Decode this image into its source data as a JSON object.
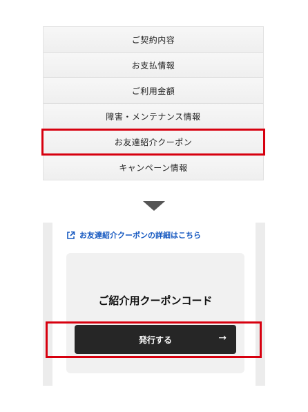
{
  "menu": {
    "items": [
      {
        "label": "ご契約内容"
      },
      {
        "label": "お支払情報"
      },
      {
        "label": "ご利用金額"
      },
      {
        "label": "障害・メンテナンス情報"
      },
      {
        "label": "お友達紹介クーポン"
      },
      {
        "label": "キャンペーン情報"
      }
    ],
    "highlighted_index": 4
  },
  "panel": {
    "detail_link": "お友達紹介クーポンの詳細はこちら",
    "card_title": "ご紹介用クーポンコード",
    "issue_button": "発行する",
    "issue_button_arrow": "→"
  },
  "colors": {
    "highlight": "#d7000f",
    "link": "#1558c0",
    "button": "#262626"
  },
  "icons": {
    "external_link": "external-link-icon",
    "arrow_down": "triangle-down-icon",
    "arrow_right": "arrow-right-icon"
  }
}
